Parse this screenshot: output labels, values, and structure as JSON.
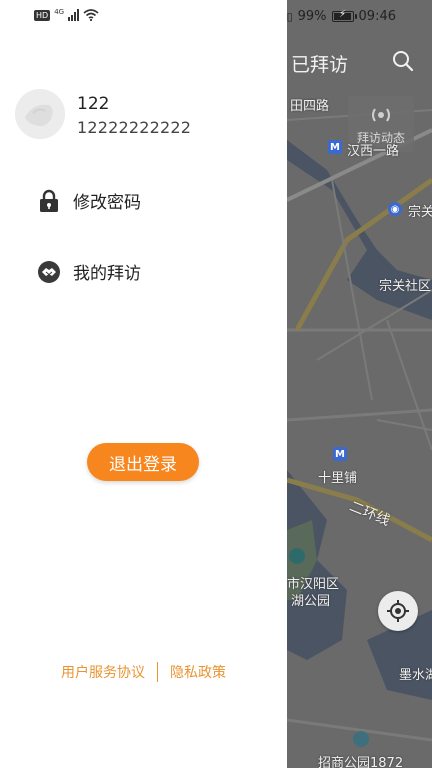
{
  "status": {
    "hd": "HD",
    "network": "4G",
    "battery_percent": "99%",
    "battery_level": 0.99,
    "time": "09:46"
  },
  "drawer": {
    "user_name": "122",
    "user_phone": "12222222222",
    "menu": [
      {
        "label": "修改密码",
        "icon": "lock-icon"
      },
      {
        "label": "我的拜访",
        "icon": "handshake-icon"
      }
    ],
    "logout_label": "退出登录",
    "footer": {
      "agreement": "用户服务协议",
      "privacy": "隐私政策"
    }
  },
  "map": {
    "title": "已拜访",
    "dynamic_label": "拜访动态",
    "labels": [
      "田四路",
      "汉西一路",
      "宗关",
      "宗关社区",
      "十里铺",
      "二环线",
      "市汉阳区",
      "湖公园",
      "墨水湖",
      "招商公园1872"
    ]
  },
  "colors": {
    "accent": "#f7861f",
    "link": "#e89432",
    "map_overlay": "#5f5f5f"
  }
}
